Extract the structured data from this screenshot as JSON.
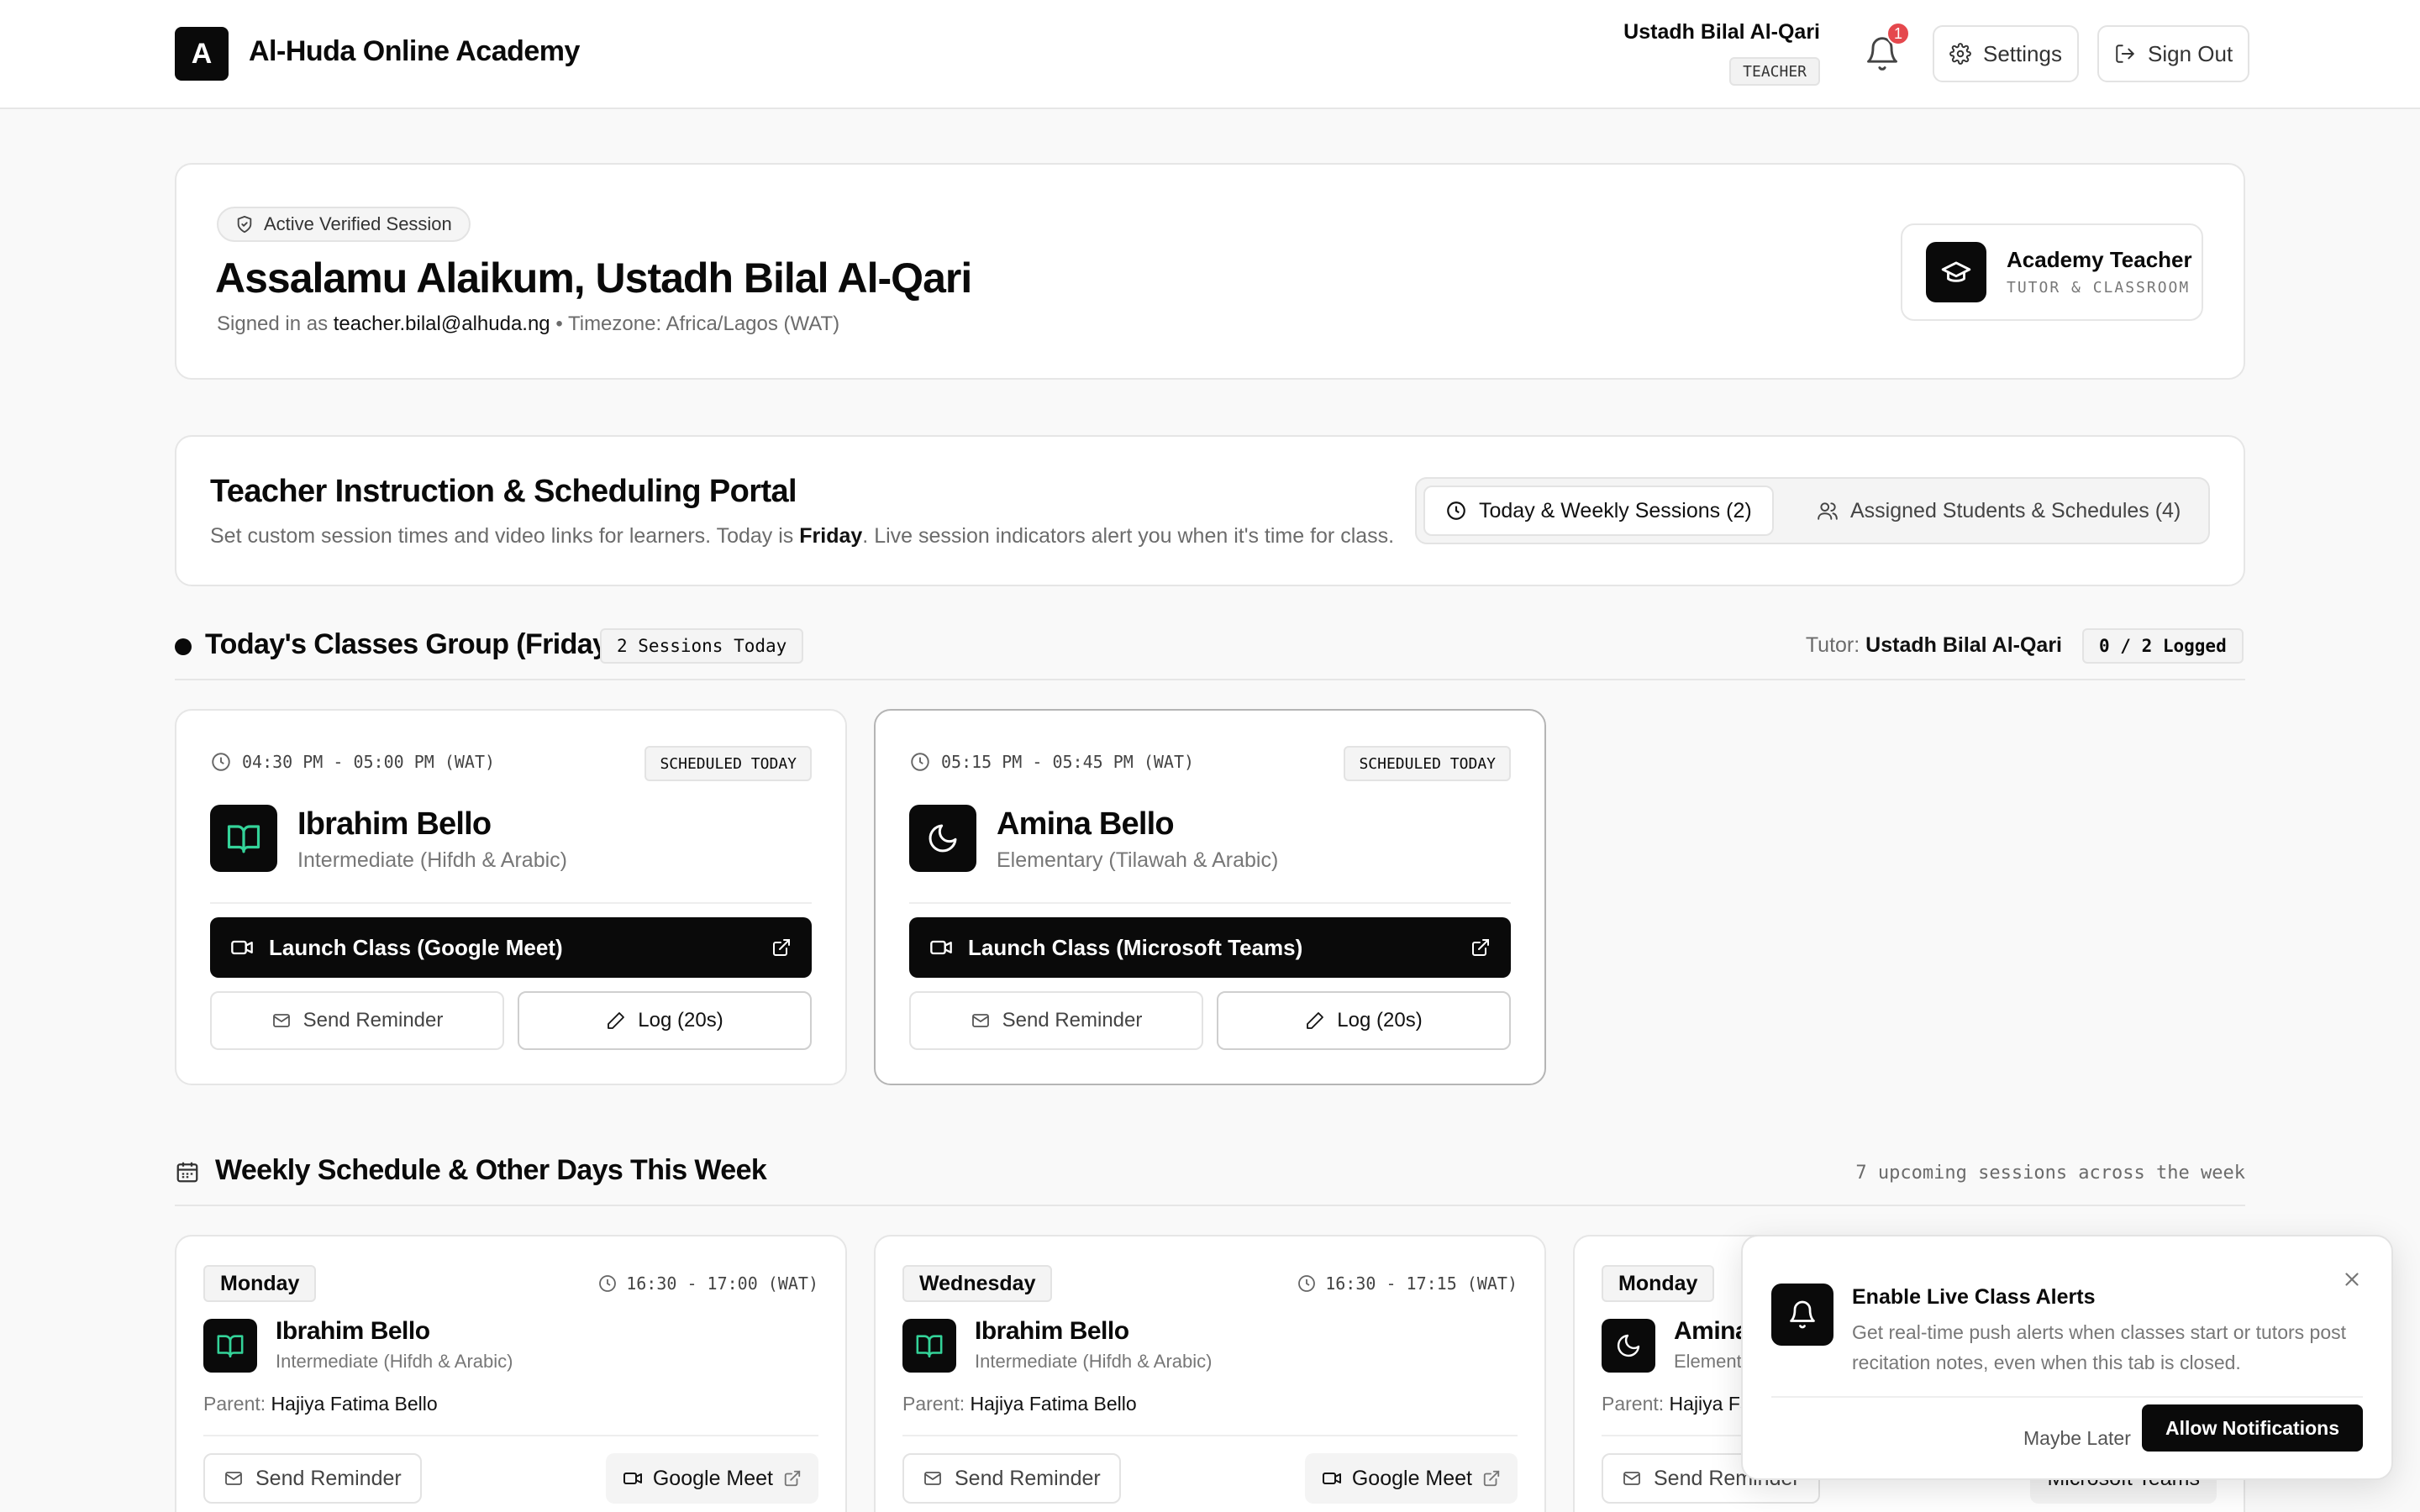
{
  "app": {
    "logo_letter": "A",
    "title": "Al-Huda Online Academy"
  },
  "user": {
    "name": "Ustadh Bilal Al-Qari",
    "role": "TEACHER",
    "notifications": "1"
  },
  "nav": {
    "settings": "Settings",
    "sign_out": "Sign Out"
  },
  "welcome": {
    "badge": "Active Verified Session",
    "greeting": "Assalamu Alaikum, Ustadh Bilal Al-Qari",
    "signed_in_prefix": "Signed in as",
    "email": "teacher.bilal@alhuda.ng",
    "timezone": "• Timezone: Africa/Lagos (WAT)",
    "role_title": "Academy Teacher",
    "role_sub": "TUTOR & CLASSROOM"
  },
  "portal": {
    "title": "Teacher Instruction & Scheduling Portal",
    "sub_a": "Set custom session times and video links for learners. Today is",
    "sub_day": "Friday",
    "sub_b": ". Live session indicators alert you when it's time for class.",
    "tab_today": "Today & Weekly Sessions (2)",
    "tab_students": "Assigned Students & Schedules (4)"
  },
  "today": {
    "title": "Today's Classes Group (Friday)",
    "count_tag": "2 Sessions Today",
    "tutor_label": "Tutor:",
    "tutor_name": "Ustadh Bilal Al-Qari",
    "logged": "0 / 2 Logged",
    "classes": [
      {
        "time": "04:30 PM - 05:00 PM (WAT)",
        "status": "SCHEDULED TODAY",
        "name": "Ibrahim Bello",
        "level": "Intermediate (Hifdh & Arabic)",
        "launch": "Launch Class (Google Meet)",
        "remind": "Send Reminder",
        "log": "Log (20s)"
      },
      {
        "time": "05:15 PM - 05:45 PM (WAT)",
        "status": "SCHEDULED TODAY",
        "name": "Amina Bello",
        "level": "Elementary (Tilawah & Arabic)",
        "launch": "Launch Class (Microsoft Teams)",
        "remind": "Send Reminder",
        "log": "Log (20s)"
      }
    ]
  },
  "weekly": {
    "title": "Weekly Schedule & Other Days This Week",
    "summary": "7 upcoming sessions across the week",
    "parent_label": "Parent:",
    "items": [
      {
        "day": "Monday",
        "time": "16:30 - 17:00 (WAT)",
        "name": "Ibrahim Bello",
        "level": "Intermediate (Hifdh & Arabic)",
        "parent": "Hajiya Fatima Bello",
        "remind": "Send Reminder",
        "link": "Google Meet"
      },
      {
        "day": "Wednesday",
        "time": "16:30 - 17:15 (WAT)",
        "name": "Ibrahim Bello",
        "level": "Intermediate (Hifdh & Arabic)",
        "parent": "Hajiya Fatima Bello",
        "remind": "Send Reminder",
        "link": "Google Meet"
      },
      {
        "day": "Monday",
        "name": "Amina",
        "level": "Element",
        "parent": "Hajiya Fa",
        "remind": "Send Reminder",
        "link": "Microsoft Teams"
      }
    ]
  },
  "toast": {
    "title": "Enable Live Class Alerts",
    "body": "Get real-time push alerts when classes start or tutors post recitation notes, even when this tab is closed.",
    "later": "Maybe Later",
    "allow": "Allow Notifications"
  }
}
